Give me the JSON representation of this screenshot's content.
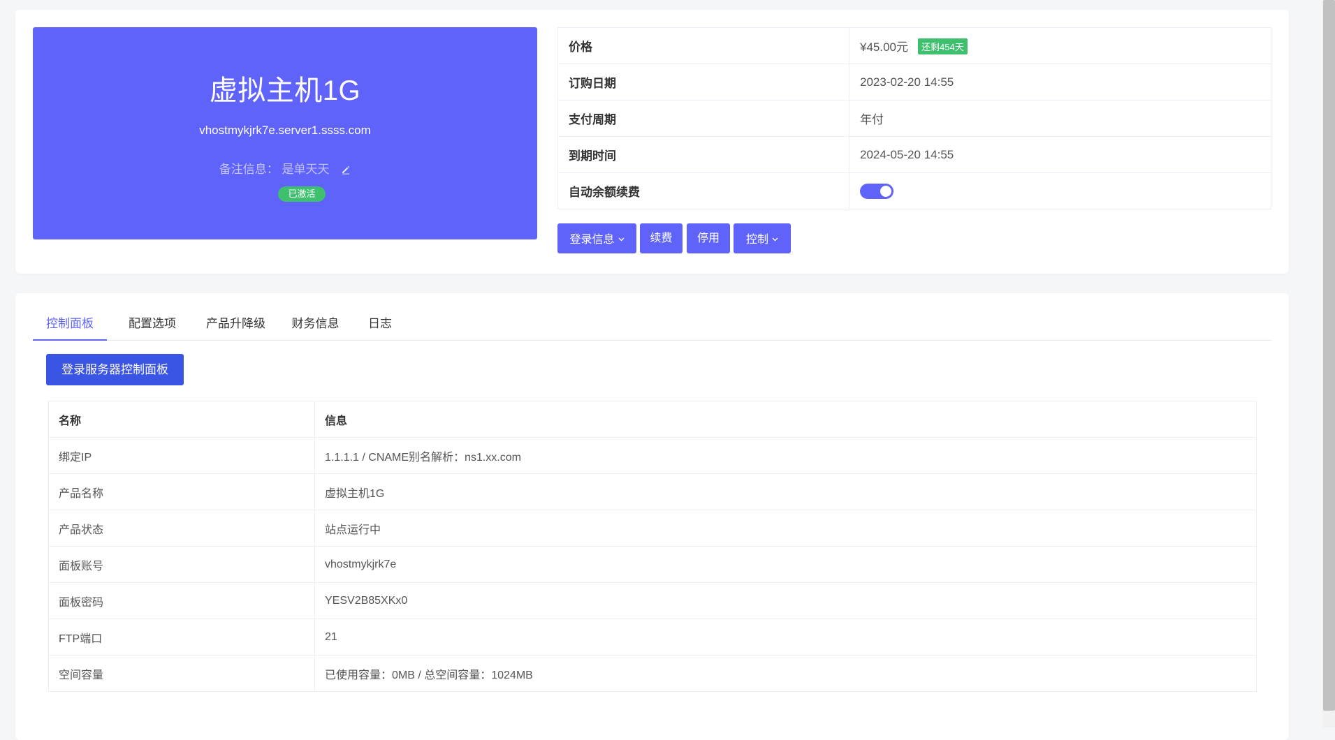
{
  "product": {
    "name": "虚拟主机1G",
    "domain": "vhostmykjrk7e.server1.ssss.com",
    "remark_label": "备注信息：",
    "remark_value": "是单天天",
    "status": "已激活"
  },
  "info": {
    "price_label": "价格",
    "price_value": "¥45.00元",
    "remain_badge": "还剩454天",
    "order_date_label": "订购日期",
    "order_date_value": "2023-02-20 14:55",
    "cycle_label": "支付周期",
    "cycle_value": "年付",
    "expire_label": "到期时间",
    "expire_value": "2024-05-20 14:55",
    "auto_renew_label": "自动余额续费",
    "auto_renew_on": true
  },
  "actions": {
    "login_info": "登录信息",
    "renew": "续费",
    "disable": "停用",
    "control": "控制"
  },
  "tabs": [
    "控制面板",
    "配置选项",
    "产品升降级",
    "财务信息",
    "日志"
  ],
  "panel": {
    "login_button": "登录服务器控制面板",
    "columns": [
      "名称",
      "信息"
    ],
    "rows": [
      [
        "绑定IP",
        "1.1.1.1 / CNAME别名解析：ns1.xx.com"
      ],
      [
        "产品名称",
        "虚拟主机1G"
      ],
      [
        "产品状态",
        "站点运行中"
      ],
      [
        "面板账号",
        "vhostmykjrk7e"
      ],
      [
        "面板密码",
        "YESV2B85XKx0"
      ],
      [
        "FTP端口",
        "21"
      ],
      [
        "空间容量",
        "已使用容量：0MB / 总空间容量：1024MB"
      ]
    ]
  },
  "colors": {
    "primary": "#5f63fa",
    "login_button": "#3a54e4",
    "success": "#3fc06e"
  }
}
